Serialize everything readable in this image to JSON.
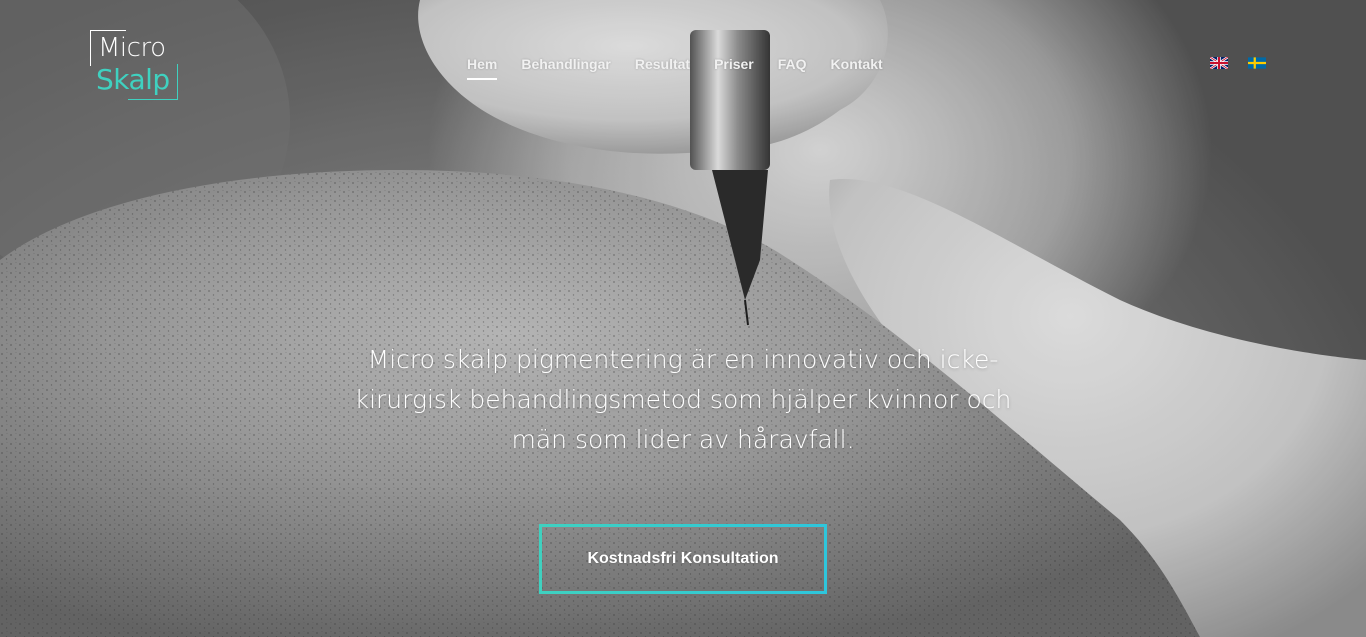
{
  "brand": {
    "logo_line1": "Micro",
    "logo_line2": "Skalp",
    "accent_color": "#3fd1c0"
  },
  "nav": {
    "items": [
      {
        "label": "Hem",
        "active": true
      },
      {
        "label": "Behandlingar",
        "active": false
      },
      {
        "label": "Resultat",
        "active": false
      },
      {
        "label": "Priser",
        "active": false
      },
      {
        "label": "FAQ",
        "active": false
      },
      {
        "label": "Kontakt",
        "active": false
      }
    ]
  },
  "languages": [
    {
      "code": "en",
      "icon": "uk-flag-icon"
    },
    {
      "code": "sv",
      "icon": "sweden-flag-icon"
    }
  ],
  "hero": {
    "headline": "Micro skalp pigmentering är en innovativ och icke-kirurgisk behandlingsmetod som hjälper kvinnor och män som lider av håravfall.",
    "cta_label": "Kostnadsfri Konsultation",
    "background": "black-and-white photo of scalp micropigmentation needle on shaved head"
  }
}
